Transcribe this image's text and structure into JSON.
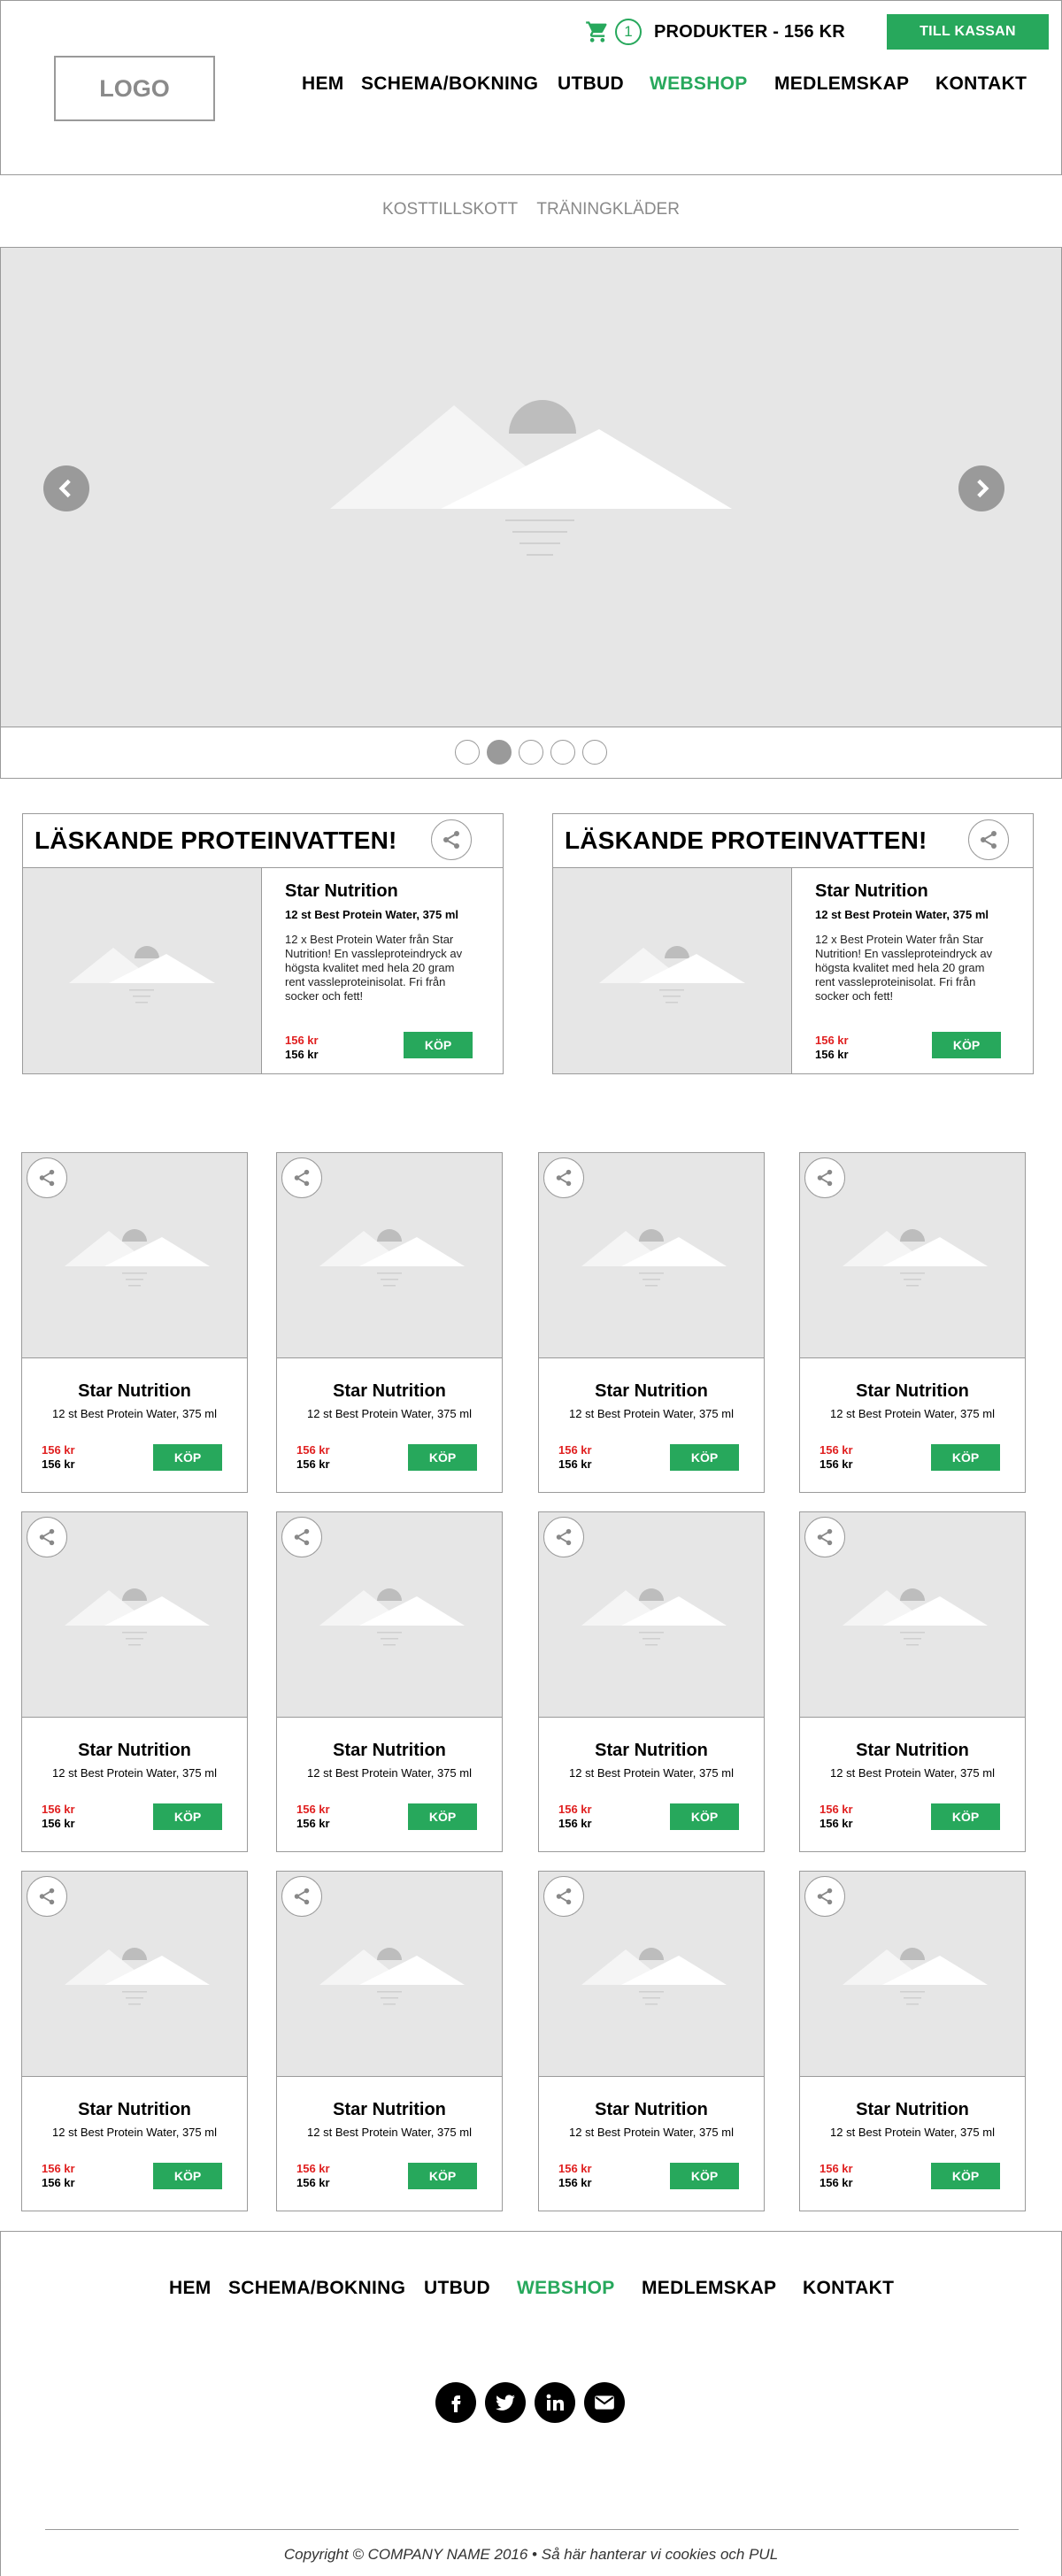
{
  "header": {
    "cart_count": "1",
    "cart_text": "PRODUKTER - 156 KR",
    "checkout_label": "TILL KASSAN",
    "logo_text": "LOGO",
    "nav": [
      "HEM",
      "SCHEMA/BOKNING",
      "UTBUD",
      "WEBSHOP",
      "MEDLEMSKAP",
      "KONTAKT"
    ],
    "active_nav": "WEBSHOP"
  },
  "sub_nav": [
    "KOSTTILLSKOTT",
    "TRÄNINGKLÄDER"
  ],
  "carousel": {
    "slide_count": 5,
    "active_index": 1
  },
  "featured": [
    {
      "title": "LÄSKANDE PROTEINVATTEN!",
      "brand": "Star Nutrition",
      "name": "12 st Best Protein Water, 375 ml",
      "description": "12 x Best Protein Water från Star Nutrition! En vassleproteindryck av högsta kvalitet med hela 20 gram rent vassleproteinisolat. Fri från socker och fett!",
      "price_old": "156 kr",
      "price_new": "156 kr",
      "buy_label": "KÖP"
    },
    {
      "title": "LÄSKANDE PROTEINVATTEN!",
      "brand": "Star Nutrition",
      "name": "12 st Best Protein Water, 375 ml",
      "description": "12 x Best Protein Water från Star Nutrition! En vassleproteindryck av högsta kvalitet med hela 20 gram rent vassleproteinisolat. Fri från socker och fett!",
      "price_old": "156 kr",
      "price_new": "156 kr",
      "buy_label": "KÖP"
    }
  ],
  "products": [
    {
      "brand": "Star Nutrition",
      "name": "12 st Best Protein Water, 375 ml",
      "price_old": "156 kr",
      "price_new": "156 kr",
      "buy_label": "KÖP"
    },
    {
      "brand": "Star Nutrition",
      "name": "12 st Best Protein Water, 375 ml",
      "price_old": "156 kr",
      "price_new": "156 kr",
      "buy_label": "KÖP"
    },
    {
      "brand": "Star Nutrition",
      "name": "12 st Best Protein Water, 375 ml",
      "price_old": "156 kr",
      "price_new": "156 kr",
      "buy_label": "KÖP"
    },
    {
      "brand": "Star Nutrition",
      "name": "12 st Best Protein Water, 375 ml",
      "price_old": "156 kr",
      "price_new": "156 kr",
      "buy_label": "KÖP"
    },
    {
      "brand": "Star Nutrition",
      "name": "12 st Best Protein Water, 375 ml",
      "price_old": "156 kr",
      "price_new": "156 kr",
      "buy_label": "KÖP"
    },
    {
      "brand": "Star Nutrition",
      "name": "12 st Best Protein Water, 375 ml",
      "price_old": "156 kr",
      "price_new": "156 kr",
      "buy_label": "KÖP"
    },
    {
      "brand": "Star Nutrition",
      "name": "12 st Best Protein Water, 375 ml",
      "price_old": "156 kr",
      "price_new": "156 kr",
      "buy_label": "KÖP"
    },
    {
      "brand": "Star Nutrition",
      "name": "12 st Best Protein Water, 375 ml",
      "price_old": "156 kr",
      "price_new": "156 kr",
      "buy_label": "KÖP"
    },
    {
      "brand": "Star Nutrition",
      "name": "12 st Best Protein Water, 375 ml",
      "price_old": "156 kr",
      "price_new": "156 kr",
      "buy_label": "KÖP"
    },
    {
      "brand": "Star Nutrition",
      "name": "12 st Best Protein Water, 375 ml",
      "price_old": "156 kr",
      "price_new": "156 kr",
      "buy_label": "KÖP"
    },
    {
      "brand": "Star Nutrition",
      "name": "12 st Best Protein Water, 375 ml",
      "price_old": "156 kr",
      "price_new": "156 kr",
      "buy_label": "KÖP"
    },
    {
      "brand": "Star Nutrition",
      "name": "12 st Best Protein Water, 375 ml",
      "price_old": "156 kr",
      "price_new": "156 kr",
      "buy_label": "KÖP"
    }
  ],
  "footer": {
    "nav": [
      "HEM",
      "SCHEMA/BOKNING",
      "UTBUD",
      "WEBSHOP",
      "MEDLEMSKAP",
      "KONTAKT"
    ],
    "active_nav": "WEBSHOP",
    "socials": [
      "facebook-icon",
      "twitter-icon",
      "linkedin-icon",
      "email-icon"
    ],
    "copyright": "Copyright © COMPANY NAME 2016 • Så här hanterar vi cookies och PUL"
  },
  "colors": {
    "accent": "#27a85c",
    "price_old": "#e02020",
    "placeholder_bg": "#e6e6e6",
    "border": "#9a9a9a"
  }
}
